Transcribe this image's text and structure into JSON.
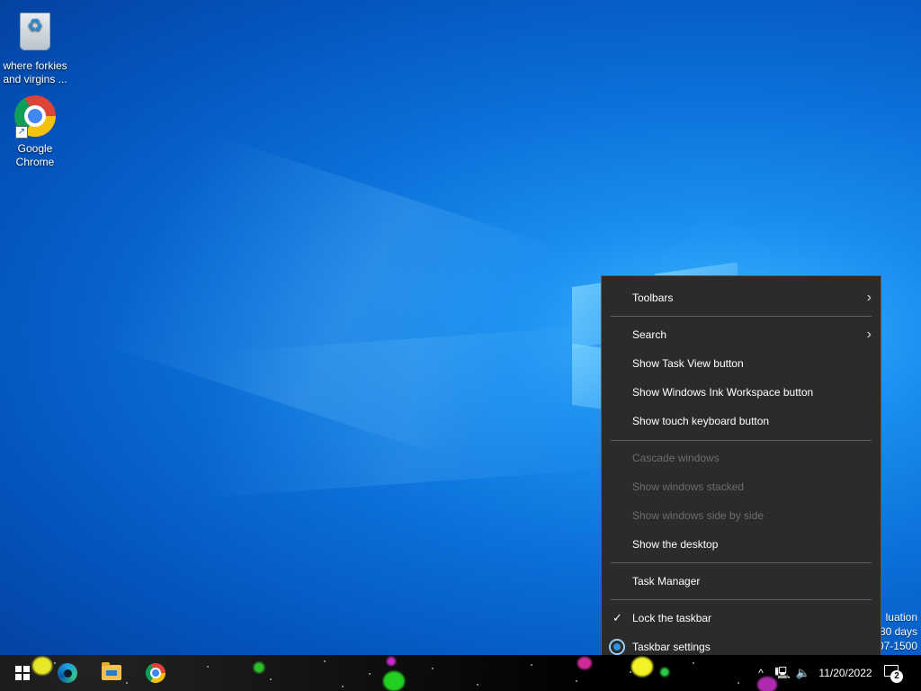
{
  "desktop": {
    "icons": [
      {
        "label": "where forkies and virgins ...",
        "icon": "recycle-bin-icon"
      },
      {
        "label": "Google Chrome",
        "icon": "chrome-icon"
      }
    ],
    "watermark": {
      "line1": "luation",
      "line2": "80 days",
      "line3": "07-1500"
    }
  },
  "context_menu": {
    "items": {
      "toolbars": "Toolbars",
      "search": "Search",
      "task_view": "Show Task View button",
      "ink_workspace": "Show Windows Ink Workspace button",
      "touch_keyboard": "Show touch keyboard button",
      "cascade": "Cascade windows",
      "stacked": "Show windows stacked",
      "side_by_side": "Show windows side by side",
      "show_desktop": "Show the desktop",
      "task_manager": "Task Manager",
      "lock_taskbar": "Lock the taskbar",
      "taskbar_settings": "Taskbar settings"
    },
    "submenu_glyph": "›",
    "check_glyph": "✓"
  },
  "taskbar": {
    "pinned": [
      "start-icon",
      "edge-icon",
      "file-explorer-icon",
      "chrome-icon"
    ],
    "tray": {
      "chevron": "^",
      "network": "🖳",
      "volume": "🔈"
    },
    "clock": "11/20/2022",
    "notification_count": "2"
  },
  "colors": {
    "menu_bg": "#2b2b2b",
    "menu_text": "#ffffff",
    "menu_disabled": "#6d6d6d",
    "taskbar_bg": "#000000"
  }
}
